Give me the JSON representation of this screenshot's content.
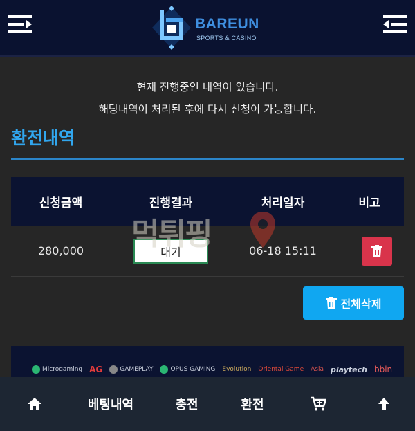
{
  "header": {
    "brand": "BAREUN",
    "brand_sub": "SPORTS & CASINO"
  },
  "notice": {
    "line1": "현재 진행중인 내역이 있습니다.",
    "line2": "해당내역이 처리된 후에 다시 신청이 가능합니다."
  },
  "section": {
    "title": "환전내역"
  },
  "table": {
    "headers": [
      "신청금액",
      "진행결과",
      "처리일자",
      "비고"
    ],
    "rows": [
      {
        "amount": "280,000",
        "status": "대기",
        "date": "06-18 15:11"
      }
    ]
  },
  "delete_all_label": "전체삭제",
  "watermark": "먹튀핑",
  "partners": [
    "Microgaming",
    "AG",
    "GAMEPLAY",
    "OPUS GAMING",
    "Evolution",
    "Oriental Game",
    "Asia",
    "playtech",
    "bbin"
  ],
  "bottom_nav": {
    "bet_history": "베팅내역",
    "deposit": "충전",
    "withdraw": "환전"
  },
  "colors": {
    "accent": "#31a6ee",
    "header_bg": "#0a1230",
    "danger": "#d9344b",
    "button": "#10a7f1"
  }
}
